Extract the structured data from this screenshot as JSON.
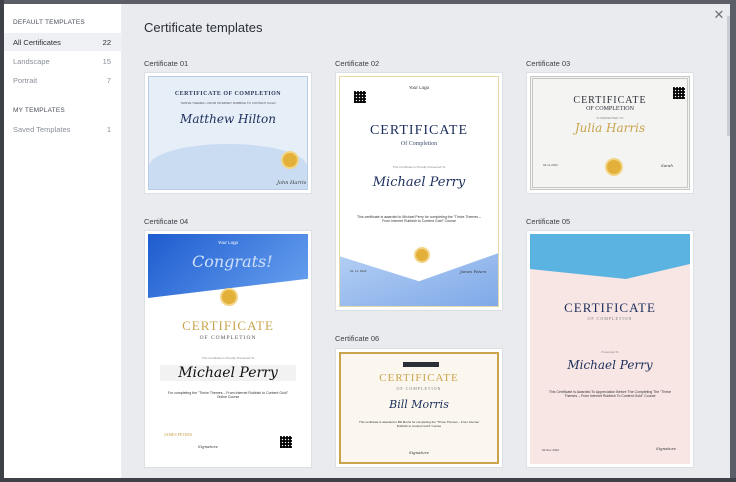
{
  "sidebar": {
    "default_heading": "DEFAULT TEMPLATES",
    "items": [
      {
        "label": "All Certificates",
        "count": "22"
      },
      {
        "label": "Landscape",
        "count": "15"
      },
      {
        "label": "Portrait",
        "count": "7"
      }
    ],
    "my_heading": "MY TEMPLATES",
    "my_items": [
      {
        "label": "Saved Templates",
        "count": "1"
      }
    ]
  },
  "main": {
    "title": "Certificate templates",
    "close_glyph": "✕"
  },
  "cards": [
    {
      "label": "Certificate 01",
      "heading": "CERTIFICATE OF COMPLETION",
      "subline": "THRIVE THEMES • FROM INTERNET RUBBISH TO CONTENT GOLD",
      "name": "Matthew Hilton",
      "sign": "John Harris"
    },
    {
      "label": "Certificate 02",
      "logo": "Your Logo",
      "heading": "CERTIFICATE",
      "sub": "Of Completion",
      "presented": "This Certificate is Proudly Presented To",
      "name": "Michael Perry",
      "body": "This certificate is awarded to Michael Perry for completing the \"Thrive Themes – From Internet Rubbish to Content Gold\" Course",
      "date": "02. 11. 2022",
      "sign": "James Peters"
    },
    {
      "label": "Certificate 03",
      "heading": "CERTIFICATE",
      "sub": "OF COMPLETION",
      "presented": "IS PRESENTED TO",
      "name": "Julia Harris",
      "date": "02.11.2022",
      "sign": "Sarah"
    },
    {
      "label": "Certificate 04",
      "logo": "Your Logo",
      "banner": "Congrats!",
      "heading": "CERTIFICATE",
      "sub": "OF COMPLETION",
      "presented": "This Certificate is Proudly Presented To",
      "name": "Michael Perry",
      "body": "For completing the \"Thrive Themes – From Internet Rubbish to Content Gold\" Online Course",
      "sign_name": "JAMES PETERS",
      "sign": "Signature"
    },
    {
      "label": "Certificate 05",
      "heading": "CERTIFICATE",
      "sub": "OF COMPLETION",
      "presented": "Presented To",
      "name": "Michael Perry",
      "body": "This Certificate Is Awarded To Appreciation Before The Completing The \"Thrive Themes – From Internet Rubbish To Content Gold\" Course",
      "date": "02 Nov 2022",
      "sign": "Signature"
    },
    {
      "label": "Certificate 06",
      "heading": "CERTIFICATE",
      "sub": "OF COMPLETION",
      "name": "Bill Morris",
      "body": "This certificate is awarded to Bill Morris for completing the \"Thrive Themes – From Internet Rubbish to Content Gold\" Course",
      "sign": "Signature"
    }
  ],
  "colors": {
    "accent_blue": "#2f6fd0",
    "gold": "#c9a44c",
    "navy": "#1c2f5c"
  }
}
